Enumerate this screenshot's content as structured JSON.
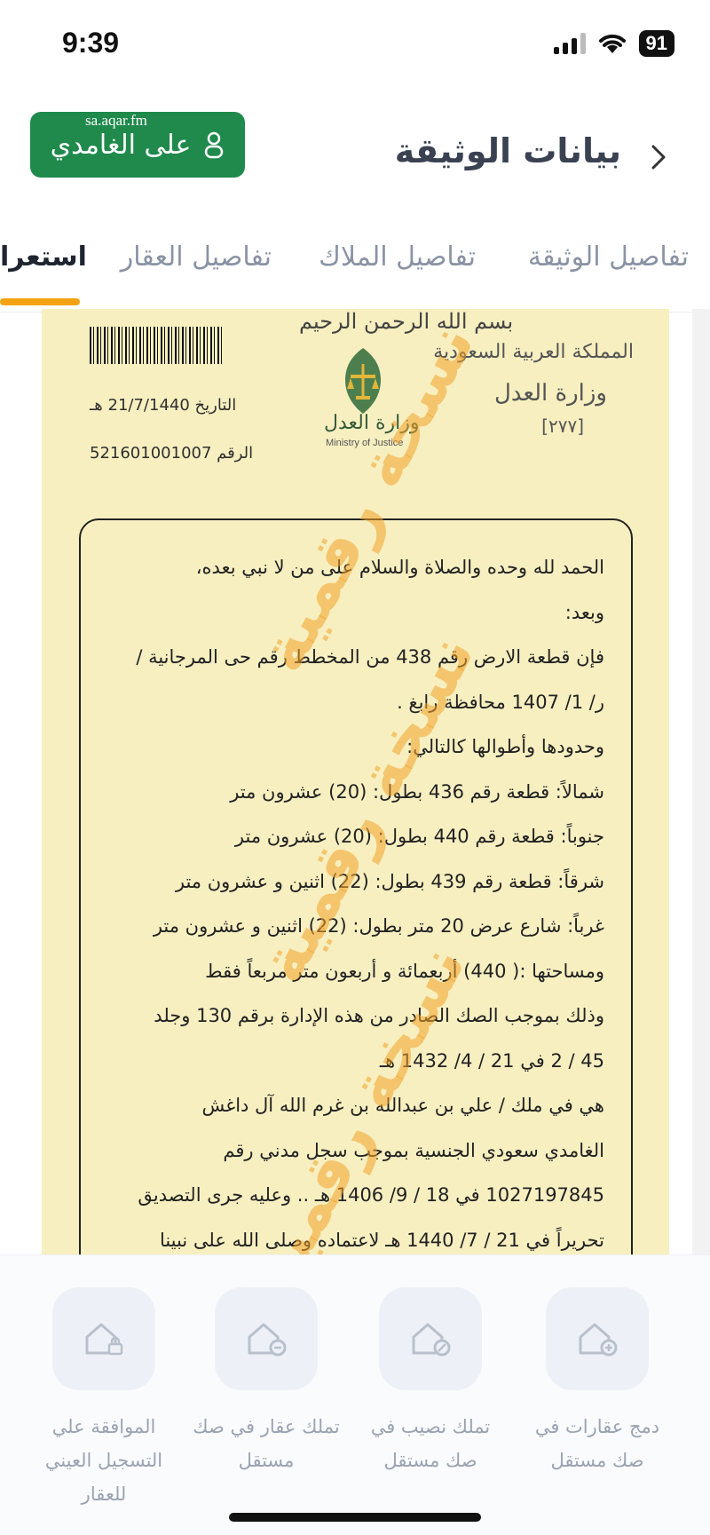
{
  "status_bar": {
    "time": "9:39",
    "battery": "91"
  },
  "header": {
    "title": "بيانات الوثيقة",
    "user_name": "على الغامدي",
    "watermark": "sa.aqar.fm"
  },
  "tabs": [
    {
      "label": "تفاصيل الوثيقة",
      "active": false
    },
    {
      "label": "تفاصيل الملاك",
      "active": false
    },
    {
      "label": "تفاصيل العقار",
      "active": false
    },
    {
      "label": "استعرا",
      "active": true
    }
  ],
  "document": {
    "basmala": "بسم الله الرحمن الرحيم",
    "kingdom": "المملكة العربية السعودية",
    "ministry": "وزارة العدل",
    "ministry_en": "Ministry of Justice",
    "serial": "[٢٧٧]",
    "date": "التاريخ 21/7/1440 هـ",
    "number": "الرقم 521601001007",
    "stamp_text": "نسخة رقمية",
    "lines": [
      "الحمد لله وحده والصلاة والسلام على من لا نبي بعده،",
      "وبعد:",
      "فإن قطعة الارض رقم 438 من المخطط رقم حى المرجانية /",
      "ر/ 1/ 1407 محافظة رابغ .",
      "وحدودها وأطوالها كالتالي:",
      "شمالاً: قطعة رقم 436    بطول: (20) عشرون متر",
      "جنوباً: قطعة رقم 440      بطول: (20) عشرون متر",
      "شرقاً: قطعة رقم 439     بطول: (22) اثنين و عشرون متر",
      "غرباً: شارع عرض 20 متر    بطول: (22) اثنين و عشرون متر",
      "ومساحتها :( 440) أربعمائة و أربعون متر مربعاً فقط",
      "وذلك بموجب الصك الصادر من هذه الإدارة برقم 130 وجلد",
      "45 / 2 في 21 / 4/ 1432 هـ",
      "هي في ملك / علي بن عبدالله بن غرم الله آل داغش",
      "الغامدي سعودي الجنسية بموجب سجل مدني رقم",
      "1027197845 في 18 / 9/ 1406 هـ .. وعليه جرى التصديق",
      "تحريراً في 21 / 7/ 1440 هـ لاعتماده وصلى الله على نبينا"
    ]
  },
  "actions": [
    {
      "label": "دمج عقارات في صك مستقل",
      "icon": "house-plus-icon"
    },
    {
      "label": "تملك نصيب في صك مستقل",
      "icon": "house-percent-icon"
    },
    {
      "label": "تملك عقار في صك مستقل",
      "icon": "house-minus-icon"
    },
    {
      "label": "الموافقة علي التسجيل العيني للعقار",
      "icon": "house-lock-icon"
    }
  ]
}
